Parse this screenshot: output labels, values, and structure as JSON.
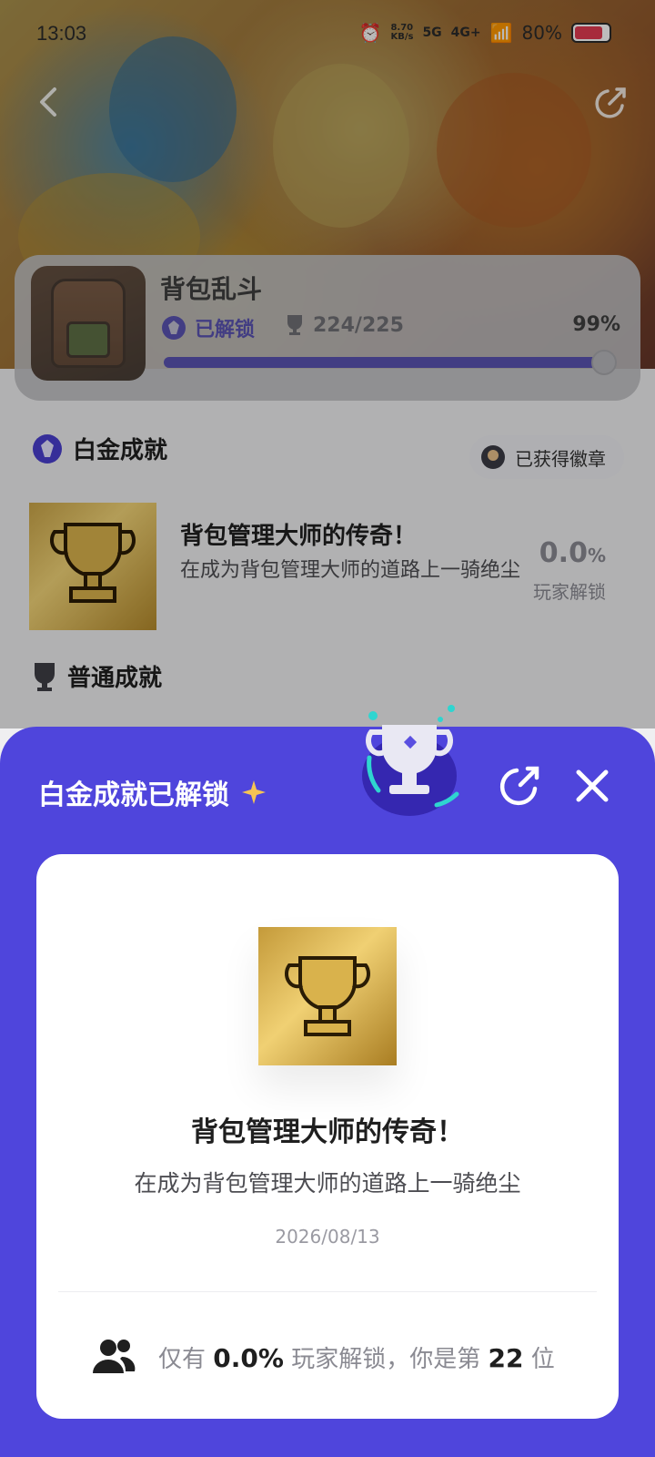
{
  "status_bar": {
    "time": "13:03",
    "speed": "8.70\nKB/s",
    "network_1": "5G",
    "network_2": "4G+",
    "battery": "80%"
  },
  "game": {
    "title": "背包乱斗",
    "unlock_status": "已解锁",
    "trophy_count": "224/225",
    "progress_pct": "99%",
    "progress_value": 0.99
  },
  "sections": {
    "platinum": "白金成就",
    "badge_button": "已获得徽章",
    "normal": "普通成就"
  },
  "achievement": {
    "title": "背包管理大师的传奇！",
    "description": "在成为背包管理大师的道路上一骑绝尘",
    "pct_value": "0.0",
    "pct_unit": "%",
    "pct_label": "玩家解锁"
  },
  "sheet": {
    "title": "白金成就已解锁",
    "card_title": "背包管理大师的传奇！",
    "card_desc": "在成为背包管理大师的道路上一骑绝尘",
    "date": "2026/08/13",
    "stats_prefix": "仅有",
    "stats_pct": "0.0%",
    "stats_mid": "玩家解锁，你是第",
    "stats_rank": "22",
    "stats_suffix": "位"
  },
  "colors": {
    "accent": "#4f45dc",
    "unlock": "#4a3fcf",
    "gold": "#d9b24c"
  }
}
